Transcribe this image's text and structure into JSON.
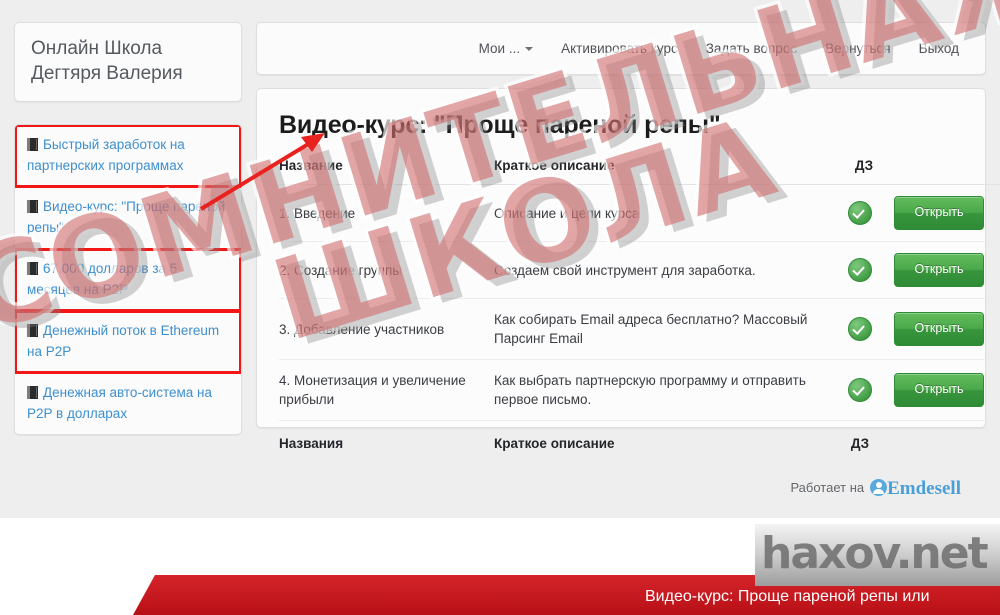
{
  "brand": {
    "title": "Онлайн Школа\nДегтяря Валерия"
  },
  "sidebar": {
    "items": [
      {
        "label": "Быстрый заработок на партнерских программах",
        "icon": "book-icon",
        "highlighted": true
      },
      {
        "label": "Видео-курс: \"Проще пареной репы\"",
        "icon": "book-icon",
        "highlighted": false
      },
      {
        "label": "67.000 долларов за 5 месяцев на P2P",
        "icon": "book-icon",
        "highlighted": true
      },
      {
        "label": "Денежный поток в Ethereum на P2P",
        "icon": "book-icon",
        "highlighted": true
      },
      {
        "label": "Денежная авто-система на P2P в долларах",
        "icon": "book-icon",
        "highlighted": false
      }
    ]
  },
  "topnav": {
    "items": [
      {
        "label": "Мои ...",
        "has_caret": true
      },
      {
        "label": "Активировать курс",
        "has_caret": false
      },
      {
        "label": "Задать вопрос",
        "has_caret": false
      },
      {
        "label": "Вернуться",
        "has_caret": false
      },
      {
        "label": "Выход",
        "has_caret": false
      }
    ]
  },
  "main": {
    "course_title": "Видео-курс: \"Проще пареной репы\"",
    "table": {
      "headers": [
        "Название",
        "Краткое описание",
        "ДЗ",
        ""
      ],
      "footers": [
        "Названия",
        "Краткое описание",
        "ДЗ",
        ""
      ],
      "rows": [
        {
          "name": "1. Введение",
          "desc": "Описание и цели курса",
          "dz": "check-done",
          "action": "Открыть"
        },
        {
          "name": "2. Создание группы",
          "desc": "Создаем свой инструмент для заработка.",
          "dz": "check-done",
          "action": "Открыть"
        },
        {
          "name": "3. Добавление участников",
          "desc": "Как собирать Email адреса бесплатно? Массовый Парсинг Email",
          "dz": "check-done",
          "action": "Открыть"
        },
        {
          "name": "4. Монетизация и увеличение прибыли",
          "desc": "Как выбрать партнерскую программу и отправить первое письмо.",
          "dz": "check-done",
          "action": "Открыть"
        }
      ]
    },
    "powered_by_prefix": "Работает на",
    "powered_by_name": "Emdesell"
  },
  "watermark": {
    "line1": "СОМНИТЕЛЬНАЯ",
    "line2": "ШКОЛА"
  },
  "bottom_banner": {
    "ribbon_text": "Видео-курс: Проще пареной репы или",
    "site_watermark": "haxov.net"
  },
  "colors": {
    "accent_link": "#3e8fcf",
    "highlight_box": "#f21717",
    "button_green": "#3f9c42",
    "ribbon_red": "#c41a20",
    "watermark_red": "#d17070"
  }
}
